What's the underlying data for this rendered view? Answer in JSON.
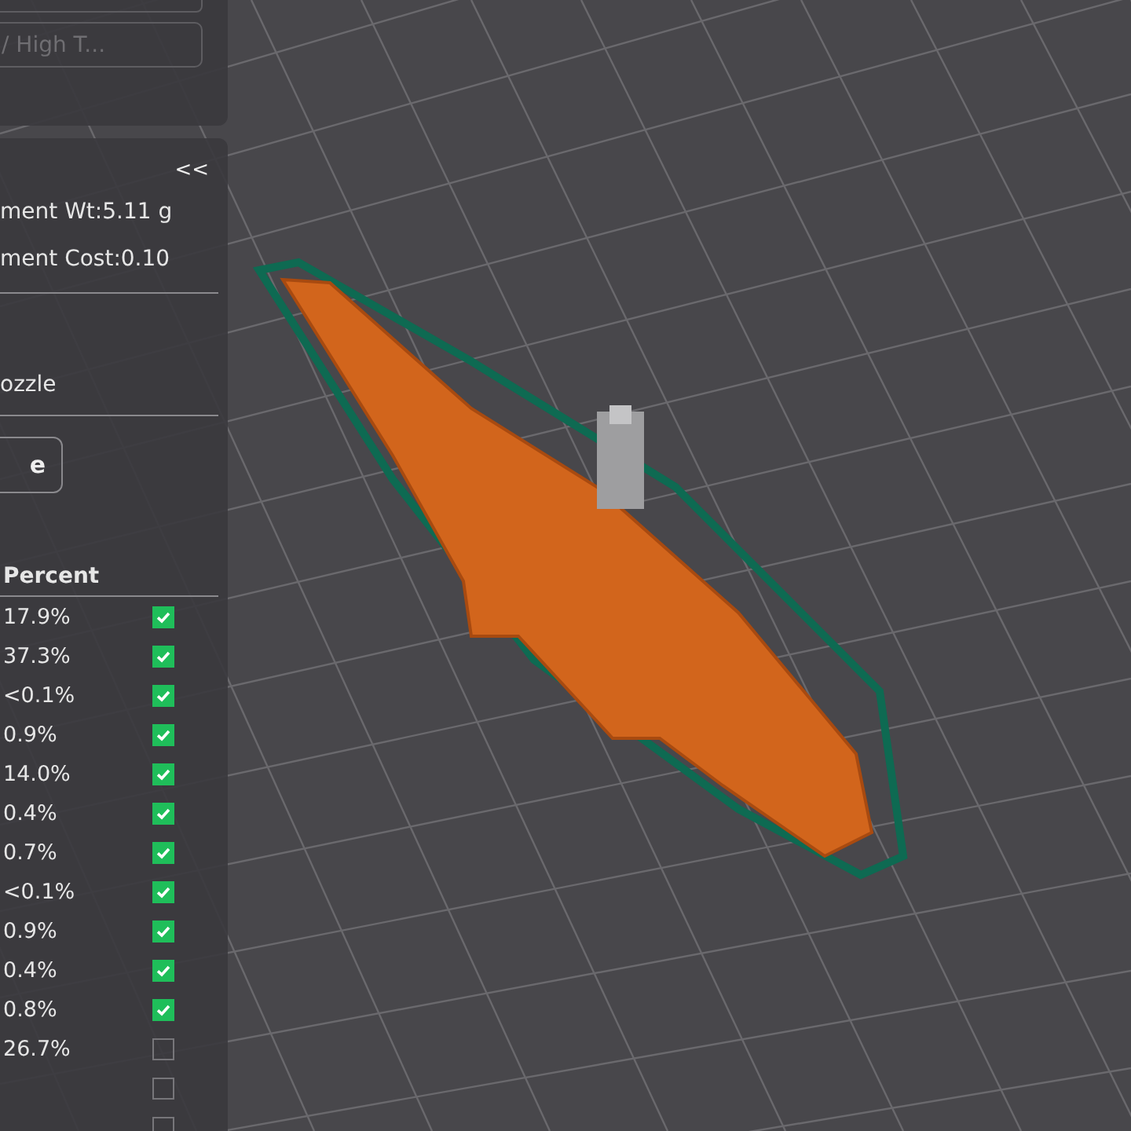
{
  "top_panel": {
    "preset_field": "/ High T..."
  },
  "stats_panel": {
    "collapse_label": "<<",
    "filament_weight": "ment Wt:5.11 g",
    "filament_cost": "ment Cost:0.10",
    "nozzle_label": "ozzle",
    "action_button": "e"
  },
  "table": {
    "columns": [
      "Percent"
    ],
    "rows": [
      {
        "percent": "17.9%",
        "checked": true
      },
      {
        "percent": "37.3%",
        "checked": true
      },
      {
        "percent": "<0.1%",
        "checked": true
      },
      {
        "percent": "0.9%",
        "checked": true
      },
      {
        "percent": "14.0%",
        "checked": true
      },
      {
        "percent": "0.4%",
        "checked": true
      },
      {
        "percent": "0.7%",
        "checked": true
      },
      {
        "percent": "<0.1%",
        "checked": true
      },
      {
        "percent": "0.9%",
        "checked": true
      },
      {
        "percent": "0.4%",
        "checked": true
      },
      {
        "percent": "0.8%",
        "checked": true
      },
      {
        "percent": "26.7%",
        "checked": false
      },
      {
        "checked": false
      },
      {
        "checked": false
      }
    ]
  }
}
